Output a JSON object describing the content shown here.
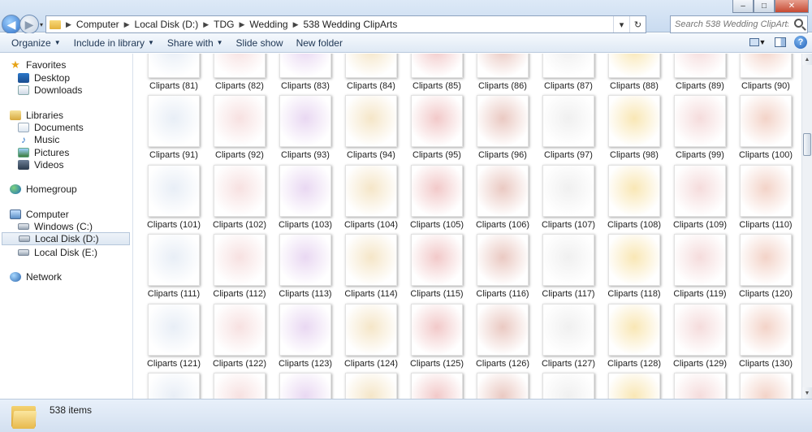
{
  "window": {
    "minimize_glyph": "–",
    "maximize_glyph": "□",
    "close_glyph": "✕"
  },
  "address": {
    "crumbs": [
      "Computer",
      "Local Disk (D:)",
      "TDG",
      "Wedding",
      "538 Wedding ClipArts"
    ],
    "separator": "▶",
    "dropdown_glyph": "▾",
    "refresh_glyph": "↻"
  },
  "search": {
    "placeholder": "Search 538 Wedding ClipArts"
  },
  "toolbar": {
    "organize": "Organize",
    "include_in_library": "Include in library",
    "share_with": "Share with",
    "slide_show": "Slide show",
    "new_folder": "New folder",
    "help_glyph": "?"
  },
  "navpane": {
    "favorites": "Favorites",
    "desktop": "Desktop",
    "downloads": "Downloads",
    "libraries": "Libraries",
    "documents": "Documents",
    "music": "Music",
    "pictures": "Pictures",
    "videos": "Videos",
    "homegroup": "Homegroup",
    "computer": "Computer",
    "windows_c": "Windows (C:)",
    "local_d": "Local Disk (D:)",
    "local_e": "Local Disk (E:)",
    "network": "Network"
  },
  "files": {
    "label_prefix": "Cliparts",
    "first_number": 81,
    "labeled_rows": 5,
    "partial_row_visible": true,
    "per_row": 10
  },
  "details": {
    "item_count": "538 items"
  },
  "colors": {
    "accent": "#2e6fc7",
    "toolbar_text": "#1e3654",
    "selection": "#dde7f2"
  }
}
